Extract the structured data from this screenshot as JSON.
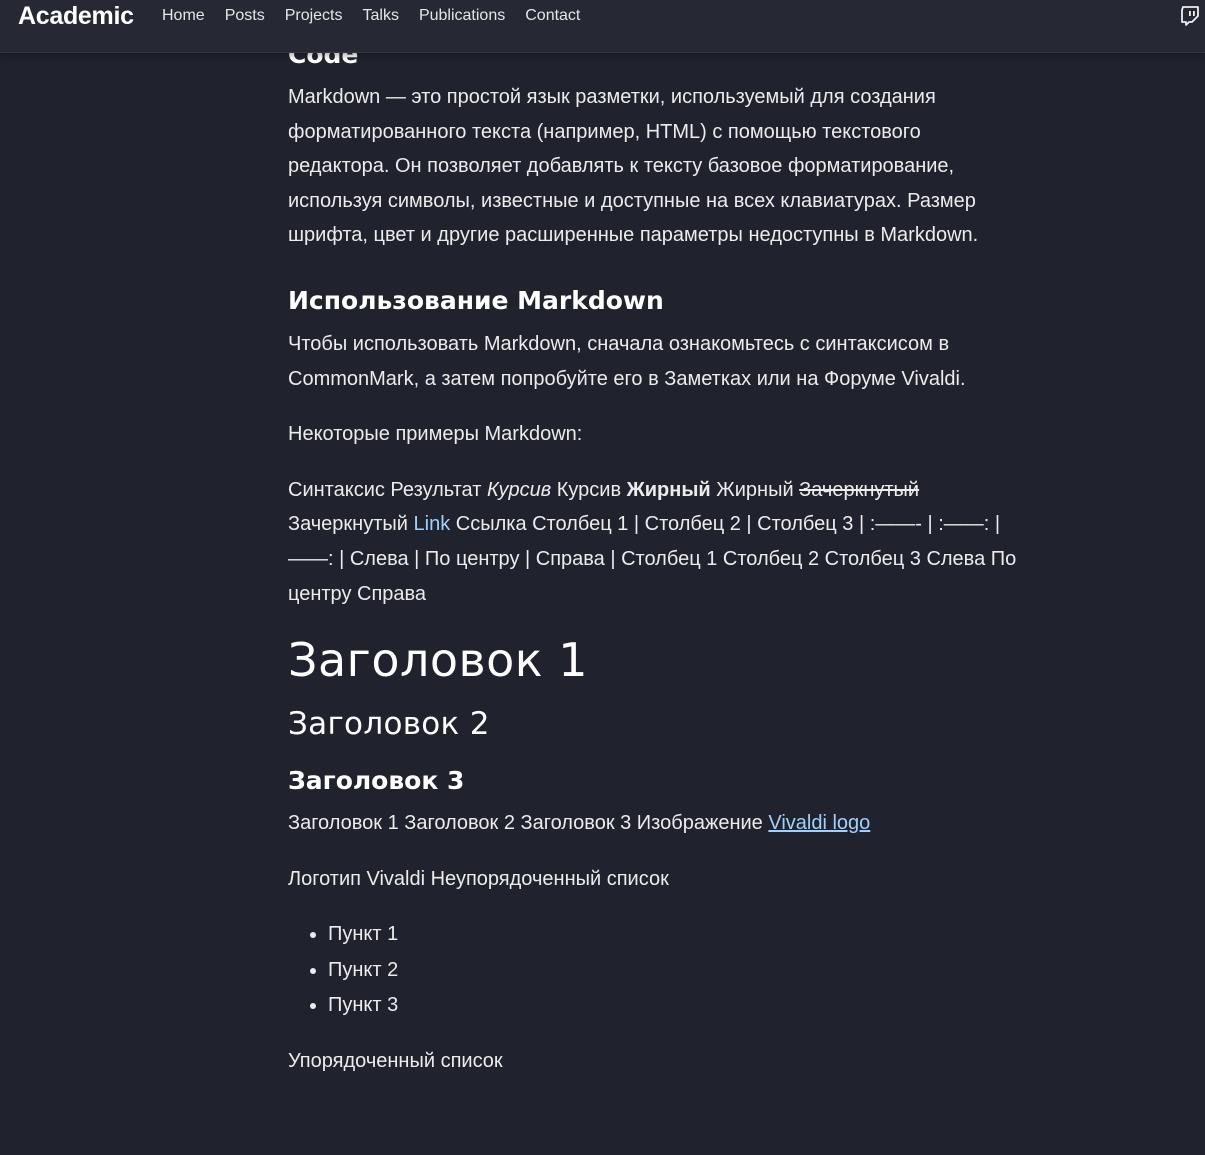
{
  "nav": {
    "brand": "Academic",
    "links": [
      "Home",
      "Posts",
      "Projects",
      "Talks",
      "Publications",
      "Contact"
    ]
  },
  "article": {
    "code_title": "Code",
    "intro": "Markdown — это простой язык разметки, используемый для создания форматированного текста (например, HTML) с помощью текстового редактора. Он позволяет добавлять к тексту базовое форматирование, используя символы, известные и доступные на всех клавиатурах. Размер шрифта, цвет и другие расширенные параметры недоступны в Markdown.",
    "usage_title": "Использование Markdown",
    "usage_text": "Чтобы использовать Markdown, сначала ознакомьтесь с синтаксисом в CommonMark, а затем попробуйте его в Заметках или на Форуме Vivaldi.",
    "examples_label": "Некоторые примеры Markdown:",
    "syntax_start": "Синтаксис Результат ",
    "italic": "Курсив",
    "after_italic": " Курсив ",
    "bold": "Жирный",
    "after_bold": " Жирный ",
    "strike": "Зачеркнутый",
    "after_strike": " Зачеркнутый ",
    "link": "Link",
    "after_link": " Ссылка Столбец 1 | Столбец 2 | Столбец 3 | :——- | :——: | ——: | Слева | По центру | Справа | Столбец 1 Столбец 2 Столбец 3 Слева По центру Справа",
    "heading1": "Заголовок 1",
    "heading2": "Заголовок 2",
    "heading3": "Заголовок 3",
    "headings_line_text": "Заголовок 1 Заголовок 2 Заголовок 3 Изображение ",
    "vivaldi_logo_link": "Vivaldi logo",
    "logo_line": "Логотип Vivaldi Неупорядоченный список",
    "list_items": [
      "Пункт 1",
      "Пункт 2",
      "Пункт 3"
    ],
    "ordered_label": "Упорядоченный список"
  },
  "colors": {
    "background": "#20232d",
    "navbar": "#262833",
    "link": "#9fd1ff"
  },
  "icons": {
    "social": "twitch-icon"
  }
}
